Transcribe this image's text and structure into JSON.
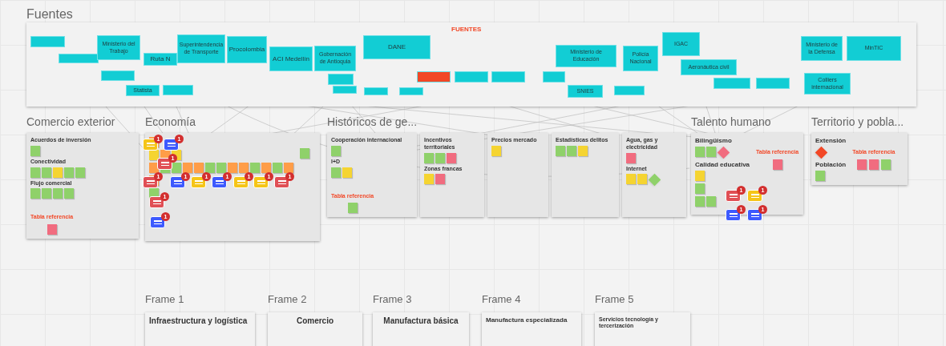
{
  "sources_frame": {
    "title": "Fuentes",
    "heading": "FUENTES",
    "sources": [
      {
        "label": "Ministerio del Trabajo"
      },
      {
        "label": "Ruta N"
      },
      {
        "label": "Superintendencia de Transporte"
      },
      {
        "label": "Procolombia"
      },
      {
        "label": "ACI Medellín"
      },
      {
        "label": "Gobernación de Antioquia"
      },
      {
        "label": "DANE"
      },
      {
        "label": "Ministerio de Educación"
      },
      {
        "label": "Policía Nacional"
      },
      {
        "label": "IGAC"
      },
      {
        "label": "Aeronáutica civil"
      },
      {
        "label": "Ministerio de la Defensa"
      },
      {
        "label": "MinTIC"
      },
      {
        "label": "SNIES"
      },
      {
        "label": "Colliers internacional"
      },
      {
        "label": "Statista"
      }
    ]
  },
  "sections": [
    {
      "title": "Comercio exterior",
      "frames": [
        {
          "groups": [
            {
              "label": "Acuerdos de inversión",
              "notes": [
                {
                  "kind": "note",
                  "color": "#8fd16a"
                }
              ]
            },
            {
              "label": "Conectividad",
              "notes": [
                {
                  "kind": "note",
                  "color": "#8fd16a"
                },
                {
                  "kind": "note",
                  "color": "#8fd16a"
                },
                {
                  "kind": "note",
                  "color": "#f5d431"
                },
                {
                  "kind": "note",
                  "color": "#8fd16a"
                },
                {
                  "kind": "note",
                  "color": "#8fd16a"
                }
              ]
            },
            {
              "label": "Flujo comercial",
              "notes": [
                {
                  "kind": "note",
                  "color": "#8fd16a"
                },
                {
                  "kind": "note",
                  "color": "#8fd16a"
                },
                {
                  "kind": "note",
                  "color": "#8fd16a"
                },
                {
                  "kind": "note",
                  "color": "#8fd16a"
                }
              ]
            }
          ],
          "reference": {
            "label": "Tabla referencia",
            "notes": [
              {
                "kind": "note",
                "color": "#f16c7f"
              }
            ]
          }
        }
      ]
    },
    {
      "title": "Economía",
      "frames": [
        {
          "groups": [
            {
              "notes": [
                {
                  "kind": "note",
                  "color": "#ff9d48"
                }
              ]
            },
            {
              "notes": [
                {
                  "kind": "note",
                  "color": "#f5d431"
                },
                {
                  "kind": "note",
                  "color": "#ff9d48"
                },
                {
                  "kind": "note",
                  "color": "#f5d431"
                }
              ]
            },
            {
              "notes": [
                {
                  "kind": "note",
                  "color": "#ff9d48"
                },
                {
                  "kind": "note",
                  "color": "#8fd16a"
                },
                {
                  "kind": "note",
                  "color": "#8fd16a"
                },
                {
                  "kind": "note",
                  "color": "#ff9d48"
                },
                {
                  "kind": "note",
                  "color": "#ff9d48"
                },
                {
                  "kind": "note",
                  "color": "#8fd16a"
                },
                {
                  "kind": "note",
                  "color": "#8fd16a"
                },
                {
                  "kind": "note",
                  "color": "#ff9d48"
                },
                {
                  "kind": "note",
                  "color": "#ff9d48"
                },
                {
                  "kind": "note",
                  "color": "#8fd16a"
                },
                {
                  "kind": "note",
                  "color": "#ff9d48"
                },
                {
                  "kind": "note",
                  "color": "#8fd16a"
                },
                {
                  "kind": "note",
                  "color": "#ff9d48"
                }
              ]
            },
            {
              "notes": [
                {
                  "kind": "note",
                  "color": "#ff9d48"
                }
              ]
            },
            {
              "notes": [
                {
                  "kind": "note",
                  "color": "#8fd16a"
                }
              ]
            }
          ],
          "reference": {
            "notes": [
              {
                "kind": "note",
                "color": "#8fd16a"
              }
            ]
          }
        }
      ]
    },
    {
      "title": "Históricos de ge...",
      "frames": [
        {
          "groups": [
            {
              "label": "Cooperación internacional",
              "notes": [
                {
                  "kind": "note",
                  "color": "#8fd16a"
                }
              ]
            },
            {
              "label": "I+D",
              "notes": [
                {
                  "kind": "note",
                  "color": "#8fd16a"
                },
                {
                  "kind": "note",
                  "color": "#f5d431"
                }
              ]
            }
          ],
          "reference": {
            "label": "Tabla referencia",
            "notes": [
              {
                "kind": "note",
                "color": "#8fd16a"
              }
            ]
          }
        },
        {
          "groups": [
            {
              "label": "Incentivos territoriales",
              "notes": [
                {
                  "kind": "note",
                  "color": "#8fd16a"
                },
                {
                  "kind": "note",
                  "color": "#8fd16a"
                },
                {
                  "kind": "note",
                  "color": "#f16c7f"
                }
              ]
            },
            {
              "label": "Zonas francas",
              "notes": [
                {
                  "kind": "note",
                  "color": "#f5d431"
                },
                {
                  "kind": "note",
                  "color": "#f16c7f"
                }
              ]
            }
          ]
        },
        {
          "groups": [
            {
              "label": "Precios mercado",
              "notes": [
                {
                  "kind": "note",
                  "color": "#f5d431"
                }
              ]
            }
          ]
        },
        {
          "groups": [
            {
              "label": "Estadísticas delitos",
              "notes": [
                {
                  "kind": "note",
                  "color": "#8fd16a"
                },
                {
                  "kind": "note",
                  "color": "#8fd16a"
                },
                {
                  "kind": "note",
                  "color": "#f5d431"
                }
              ]
            }
          ]
        },
        {
          "groups": [
            {
              "label": "Agua, gas y electricidad",
              "notes": [
                {
                  "kind": "note",
                  "color": "#f16c7f"
                }
              ]
            },
            {
              "label": "Internet",
              "notes": [
                {
                  "kind": "note",
                  "color": "#f5d431"
                },
                {
                  "kind": "note",
                  "color": "#f5d431"
                },
                {
                  "kind": "diamond",
                  "color": "#8fd16a"
                }
              ]
            }
          ]
        }
      ]
    },
    {
      "title": "Talento humano",
      "frames": [
        {
          "groups": [
            {
              "label": "Bilingüismo",
              "notes": [
                {
                  "kind": "note",
                  "color": "#8fd16a"
                },
                {
                  "kind": "note",
                  "color": "#8fd16a"
                },
                {
                  "kind": "diamond",
                  "color": "#f16c7f"
                }
              ]
            },
            {
              "label": "Calidad educativa",
              "notes": [
                {
                  "kind": "note",
                  "color": "#f5d431"
                }
              ]
            },
            {
              "notes": [
                {
                  "kind": "note",
                  "color": "#8fd16a"
                }
              ]
            },
            {
              "notes": [
                {
                  "kind": "note",
                  "color": "#8fd16a"
                },
                {
                  "kind": "note",
                  "color": "#8fd16a"
                }
              ]
            }
          ],
          "reference": {
            "label": "Tabla referencia",
            "notes": [
              {
                "kind": "note",
                "color": "#f16c7f"
              }
            ]
          }
        }
      ]
    },
    {
      "title": "Territorio y pobla...",
      "frames": [
        {
          "groups": [
            {
              "label": "Extensión",
              "notes": [
                {
                  "kind": "diamond",
                  "color": "#f24726"
                }
              ]
            },
            {
              "label": "Población",
              "notes": [
                {
                  "kind": "note",
                  "color": "#8fd16a"
                }
              ]
            }
          ],
          "reference": {
            "label": "Tabla referencia",
            "notes": [
              {
                "kind": "note",
                "color": "#f16c7f"
              },
              {
                "kind": "note",
                "color": "#f16c7f"
              },
              {
                "kind": "note",
                "color": "#8fd16a"
              }
            ]
          }
        }
      ]
    }
  ],
  "comments": [
    {
      "color": "#f5c518",
      "count": "1"
    },
    {
      "color": "#3d5afe",
      "count": "1"
    },
    {
      "color": "#e04f55",
      "count": "1"
    },
    {
      "color": "#e04f55",
      "count": "1"
    },
    {
      "color": "#3d5afe",
      "count": "1"
    },
    {
      "color": "#f5c518",
      "count": "1"
    },
    {
      "color": "#3d5afe",
      "count": "1"
    },
    {
      "color": "#f5c518",
      "count": "1"
    },
    {
      "color": "#f5c518",
      "count": "1"
    },
    {
      "color": "#e04f55",
      "count": "1"
    },
    {
      "color": "#e04f55",
      "count": "1"
    },
    {
      "color": "#3d5afe",
      "count": "1"
    },
    {
      "color": "#e04f55",
      "count": "1"
    },
    {
      "color": "#f5c518",
      "count": "1"
    },
    {
      "color": "#3d5afe",
      "count": "1"
    },
    {
      "color": "#3d5afe",
      "count": "1"
    }
  ],
  "bottom_frames": [
    {
      "title": "Frame 1",
      "heading": "Infraestructura y logística"
    },
    {
      "title": "Frame 2",
      "heading": "Comercio"
    },
    {
      "title": "Frame 3",
      "heading": "Manufactura básica"
    },
    {
      "title": "Frame 4",
      "heading": "Manufactura especializada"
    },
    {
      "title": "Frame 5",
      "heading": "Servicios tecnología y tercerización"
    }
  ]
}
